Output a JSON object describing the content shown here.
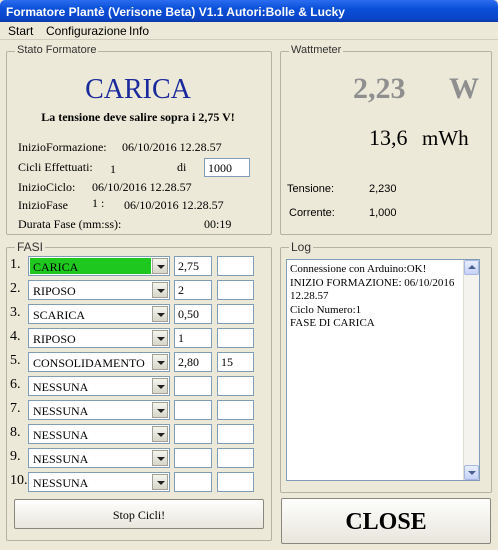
{
  "window": {
    "title": "Formatore Plantè (Verisone Beta) V1.1 Autori:Bolle & Lucky"
  },
  "menu": [
    "Start",
    "Configurazione",
    "Info"
  ],
  "stato": {
    "group_title": "Stato Formatore",
    "status": "CARICA",
    "message": "La tensione deve salire sopra i 2,75 V!",
    "inizio_formazione_label": "InizioFormazione:",
    "inizio_formazione_value": "06/10/2016 12.28.57",
    "cicli_label": "Cicli Effettuati:",
    "cicli_value": "1",
    "di_label": "di",
    "cicli_totali": "1000",
    "inizio_ciclo_label": "InizioCiclo:",
    "inizio_ciclo_value": "06/10/2016 12.28.57",
    "inizio_fase_label": "InizioFase",
    "inizio_fase_num": "1 :",
    "inizio_fase_value": "06/10/2016 12.28.57",
    "durata_label": "Durata Fase (mm:ss):",
    "durata_value": "00:19"
  },
  "wattmeter": {
    "group_title": "Wattmeter",
    "power_value": "2,23",
    "power_unit": "W",
    "energy_value": "13,6",
    "energy_unit": "mWh",
    "tensione_label": "Tensione:",
    "tensione_value": "2,230",
    "corrente_label": "Corrente:",
    "corrente_value": "1,000"
  },
  "fasi": {
    "group_title": "FASI",
    "rows": [
      {
        "num": "1.",
        "phase": "CARICA",
        "p1": "2,75",
        "p2": ""
      },
      {
        "num": "2.",
        "phase": "RIPOSO",
        "p1": "2",
        "p2": ""
      },
      {
        "num": "3.",
        "phase": "SCARICA",
        "p1": "0,50",
        "p2": ""
      },
      {
        "num": "4.",
        "phase": "RIPOSO",
        "p1": "1",
        "p2": ""
      },
      {
        "num": "5.",
        "phase": "CONSOLIDAMENTO",
        "p1": "2,80",
        "p2": "15"
      },
      {
        "num": "6.",
        "phase": "NESSUNA",
        "p1": "",
        "p2": ""
      },
      {
        "num": "7.",
        "phase": "NESSUNA",
        "p1": "",
        "p2": ""
      },
      {
        "num": "8.",
        "phase": "NESSUNA",
        "p1": "",
        "p2": ""
      },
      {
        "num": "9.",
        "phase": "NESSUNA",
        "p1": "",
        "p2": ""
      },
      {
        "num": "10.",
        "phase": "NESSUNA",
        "p1": "",
        "p2": ""
      }
    ],
    "stop_label": "Stop Cicli!"
  },
  "log": {
    "group_title": "Log",
    "lines": [
      "Connessione con Arduino:OK!",
      "INIZIO FORMAZIONE: 06/10/2016",
      "12.28.57",
      "Ciclo Numero:1",
      "FASE DI CARICA"
    ]
  },
  "close_label": "CLOSE",
  "colors": {
    "active_phase": "#1ec81e",
    "status_text": "#1a2a9c",
    "title_bar": "#0a4fd8"
  }
}
